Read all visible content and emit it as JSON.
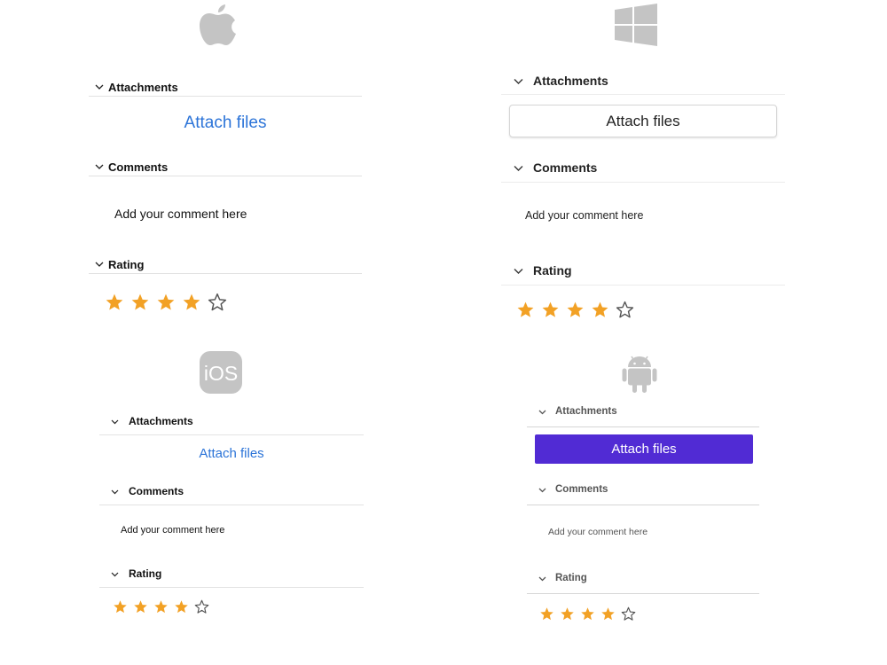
{
  "colors": {
    "star_filled": "#f2a125",
    "star_empty": "#555555",
    "mac_link": "#2c74d8",
    "android_button": "#512bd4",
    "logo_gray": "#c4c4c4"
  },
  "panels": {
    "macos": {
      "logo": "apple-logo-icon",
      "attachments_label": "Attachments",
      "attach_label": "Attach files",
      "comments_label": "Comments",
      "comment_placeholder": "Add your comment here",
      "rating_label": "Rating",
      "rating_value": 4,
      "rating_max": 5
    },
    "windows": {
      "logo": "windows-logo-icon",
      "attachments_label": "Attachments",
      "attach_label": "Attach files",
      "comments_label": "Comments",
      "comment_placeholder": "Add your comment here",
      "rating_label": "Rating",
      "rating_value": 4,
      "rating_max": 5
    },
    "ios": {
      "logo": "ios-logo-icon",
      "logo_text": "iOS",
      "attachments_label": "Attachments",
      "attach_label": "Attach files",
      "comments_label": "Comments",
      "comment_placeholder": "Add your comment here",
      "rating_label": "Rating",
      "rating_value": 4,
      "rating_max": 5
    },
    "android": {
      "logo": "android-logo-icon",
      "attachments_label": "Attachments",
      "attach_label": "Attach files",
      "comments_label": "Comments",
      "comment_placeholder": "Add your comment here",
      "rating_label": "Rating",
      "rating_value": 4,
      "rating_max": 5
    }
  }
}
